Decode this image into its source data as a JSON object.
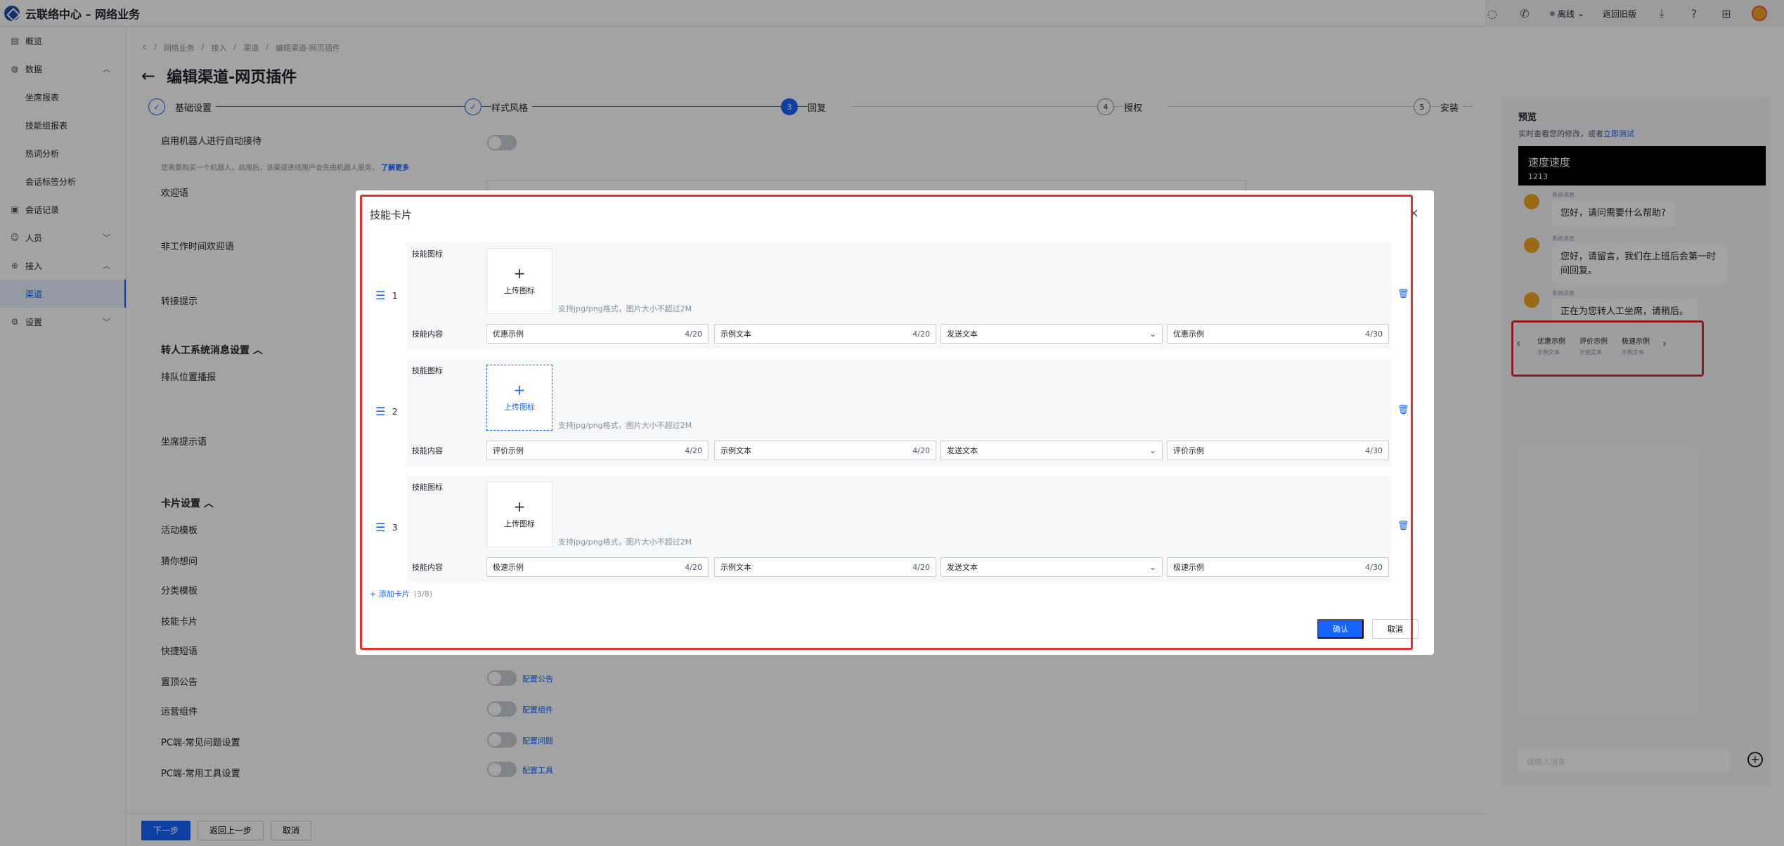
{
  "app": {
    "title": "云联络中心 – 网络业务"
  },
  "topbar": {
    "status": "离线",
    "back_old": "返回旧版"
  },
  "sidebar": {
    "items": [
      {
        "label": "概览",
        "icon": "overview-icon"
      },
      {
        "label": "数据",
        "icon": "data-icon"
      },
      {
        "label": "坐席报表"
      },
      {
        "label": "技能组报表"
      },
      {
        "label": "热词分析"
      },
      {
        "label": "会话标签分析"
      },
      {
        "label": "会话记录",
        "icon": "record-icon"
      },
      {
        "label": "人员",
        "icon": "people-icon"
      },
      {
        "label": "接入",
        "icon": "access-icon"
      },
      {
        "label": "渠道"
      },
      {
        "label": "设置",
        "icon": "settings-icon"
      }
    ]
  },
  "breadcrumb": [
    "c",
    "网络业务",
    "接入",
    "渠道",
    "编辑渠道-网页插件"
  ],
  "page": {
    "title": "编辑渠道-网页插件"
  },
  "steps": [
    {
      "num": "✓",
      "label": "基础设置"
    },
    {
      "num": "✓",
      "label": "样式风格"
    },
    {
      "num": "3",
      "label": "回复"
    },
    {
      "num": "4",
      "label": "授权"
    },
    {
      "num": "5",
      "label": "安装"
    }
  ],
  "form": {
    "robot_label": "启用机器人进行自动接待",
    "robot_hint": "您需要购买一个机器人，启用后，该渠道进线用户会先由机器人服务。",
    "robot_link": "了解更多",
    "welcome": "欢迎语",
    "offhours": "非工作时间欢迎语",
    "transfer": "转接提示",
    "section_transfer": "转人工系统消息设置",
    "queue": "排队位置播报",
    "agent_tip": "坐席提示语",
    "section_card": "卡片设置",
    "activity": "活动模板",
    "guess": "猜你想问",
    "category": "分类模板",
    "skill": "技能卡片",
    "quick": "快捷短语",
    "pinned": "置顶公告",
    "pinned_link": "配置公告",
    "ops": "运营组件",
    "ops_link": "配置组件",
    "faq": "PC端-常见问题设置",
    "faq_link": "配置问题",
    "tools": "PC端-常用工具设置",
    "tools_link": "配置工具"
  },
  "footer": {
    "next": "下一步",
    "prev": "返回上一步",
    "cancel": "取消"
  },
  "preview": {
    "title": "预览",
    "subtitle": "实时查看您的修改，或者",
    "test_link": "立即测试",
    "header_name": "速度速度",
    "header_sub": "1213",
    "sender": "系统消息",
    "messages": [
      "您好，请问需要什么帮助?",
      "您好，请留言，我们在上班后会第一时间回复。",
      "正在为您转人工坐席，请稍后。"
    ],
    "chips": [
      {
        "title": "优惠示例",
        "sub": "示例文本"
      },
      {
        "title": "评价示例",
        "sub": "示例文本"
      },
      {
        "title": "极速示例",
        "sub": "示例文本"
      }
    ],
    "input_placeholder": "请输入消息"
  },
  "modal": {
    "title": "技能卡片",
    "icon_label": "技能图标",
    "content_label": "技能内容",
    "upload_label": "上传图标",
    "upload_hint": "支持jpg/png格式，图片大小不超过2M",
    "cards": [
      {
        "idx": "1",
        "name": "优惠示例",
        "name_count": "4/20",
        "text": "示例文本",
        "text_count": "4/20",
        "type": "发送文本",
        "send": "优惠示例",
        "send_count": "4/30"
      },
      {
        "idx": "2",
        "name": "评价示例",
        "name_count": "4/20",
        "text": "示例文本",
        "text_count": "4/20",
        "type": "发送文本",
        "send": "评价示例",
        "send_count": "4/30"
      },
      {
        "idx": "3",
        "name": "极速示例",
        "name_count": "4/20",
        "text": "示例文本",
        "text_count": "4/20",
        "type": "发送文本",
        "send": "极速示例",
        "send_count": "4/30"
      }
    ],
    "add_card": "+ 添加卡片",
    "add_count": "(3/8)",
    "confirm": "确认",
    "cancel": "取消"
  },
  "colors": {
    "accent": "#1664ff",
    "highlight": "#e03131",
    "mask": "rgba(0,0,0,0.36)"
  }
}
